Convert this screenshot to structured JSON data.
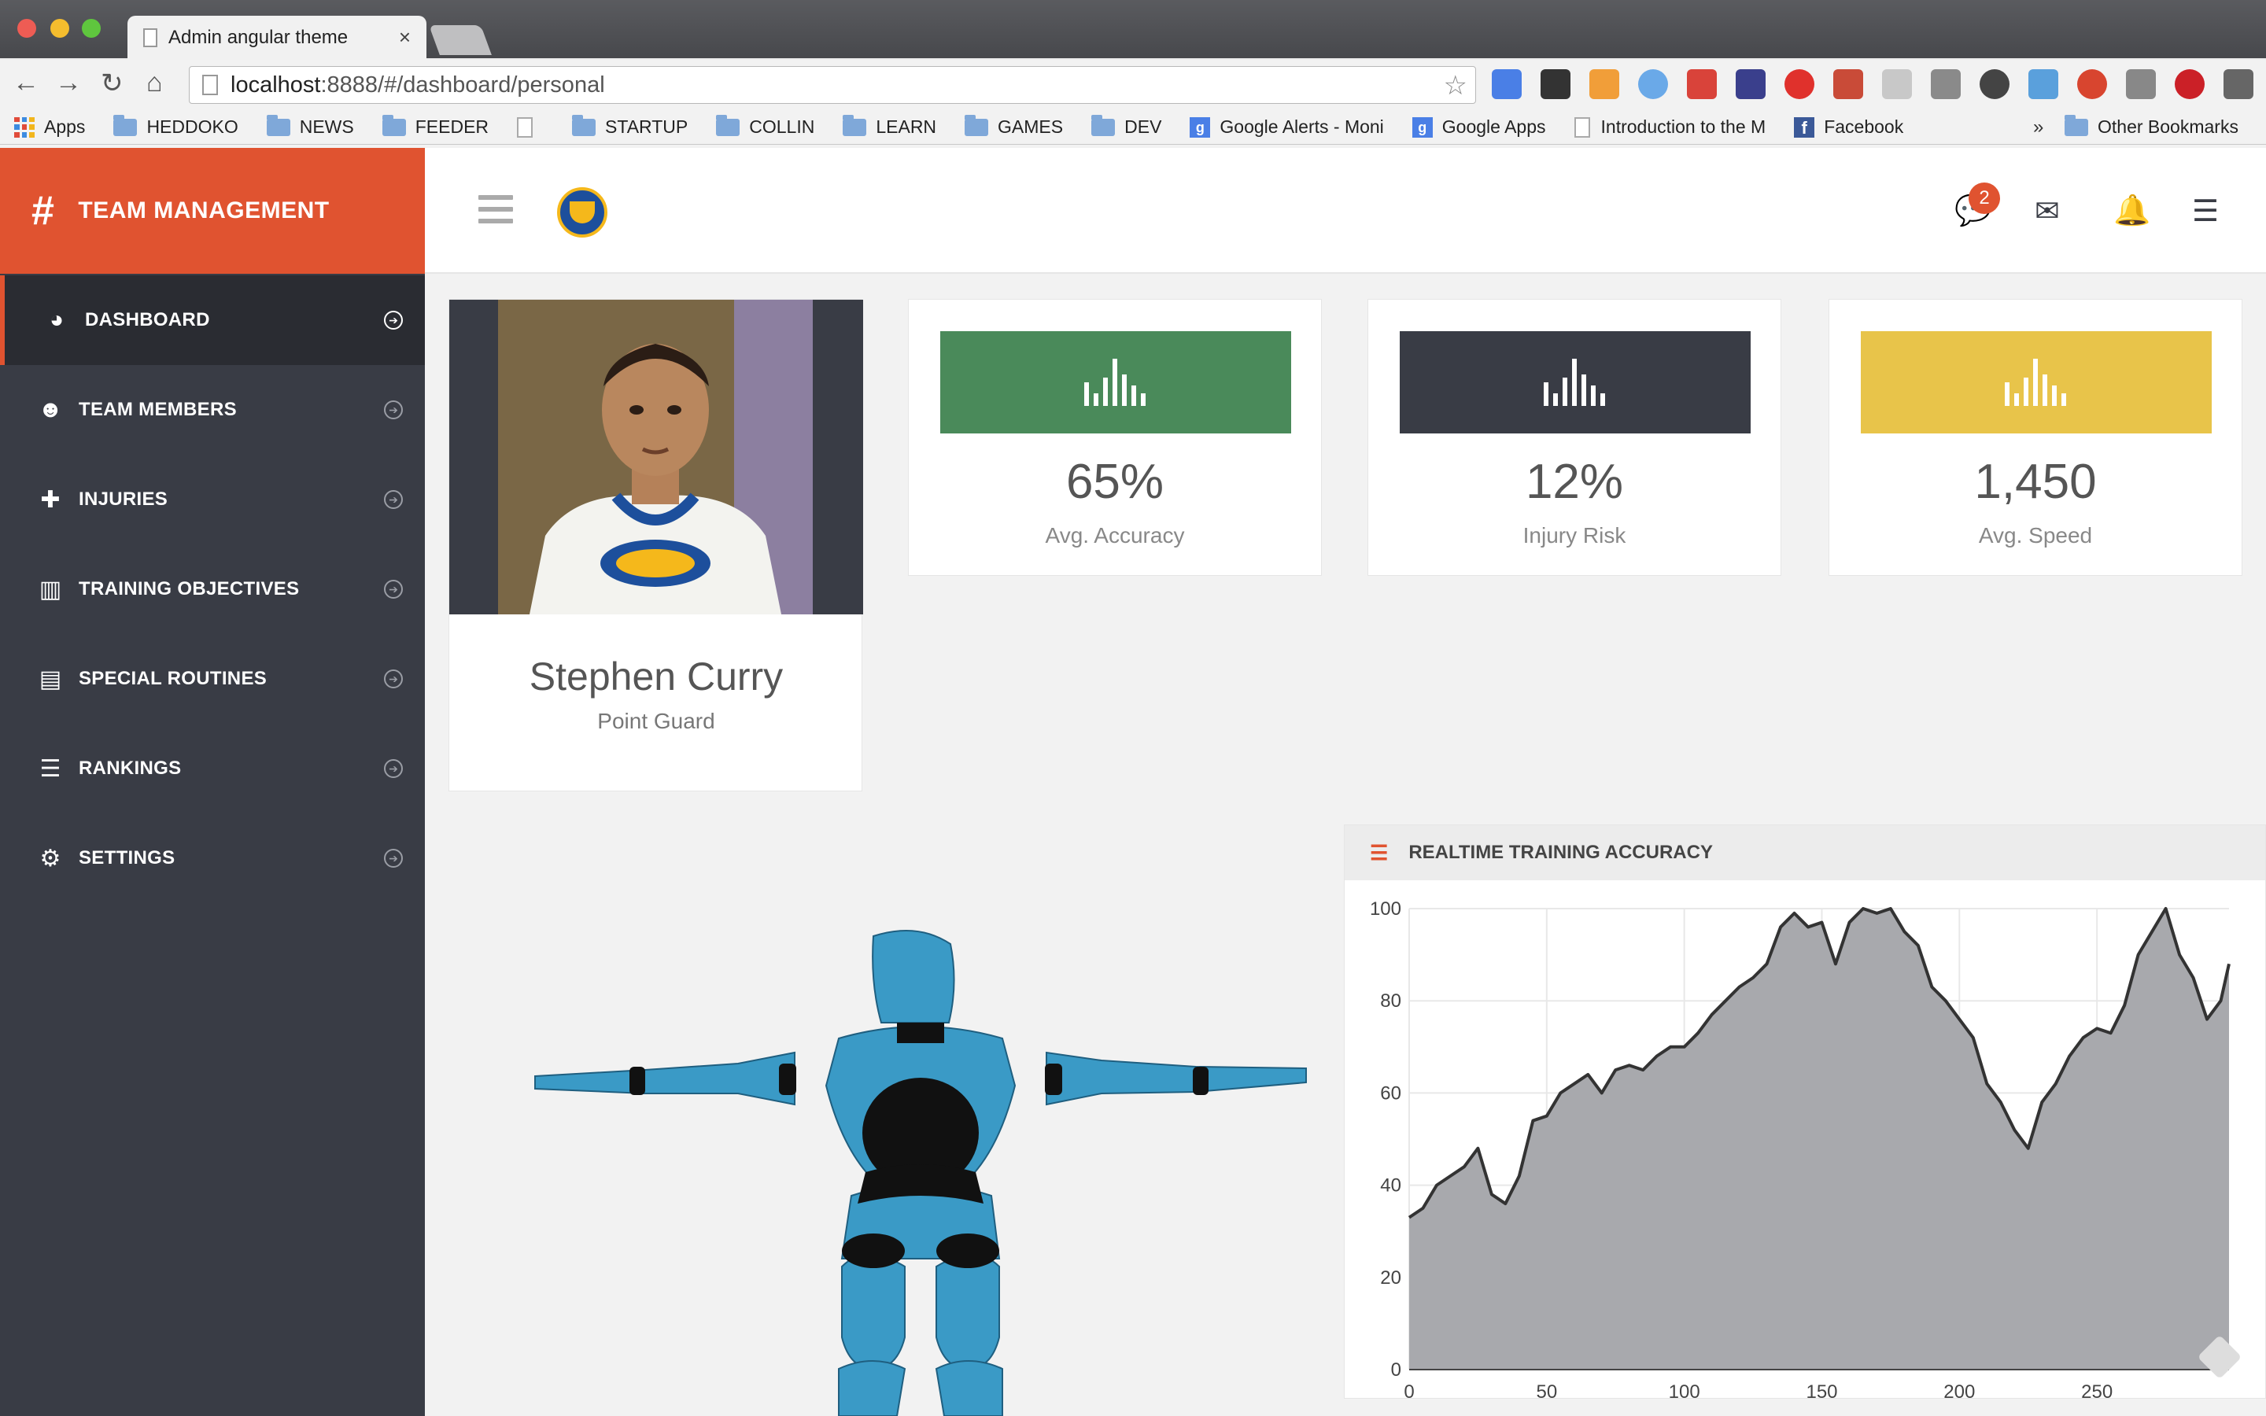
{
  "browser": {
    "tab_title": "Admin angular theme",
    "tab_close": "×",
    "url_host": "localhost",
    "url_rest": ":8888/#/dashboard/personal",
    "bookmarks": [
      {
        "label": "Apps",
        "type": "apps"
      },
      {
        "label": "HEDDOKO",
        "type": "folder"
      },
      {
        "label": "NEWS",
        "type": "folder"
      },
      {
        "label": "FEEDER",
        "type": "folder"
      },
      {
        "label": "",
        "type": "page"
      },
      {
        "label": "STARTUP",
        "type": "folder"
      },
      {
        "label": "COLLIN",
        "type": "folder"
      },
      {
        "label": "LEARN",
        "type": "folder"
      },
      {
        "label": "GAMES",
        "type": "folder"
      },
      {
        "label": "DEV",
        "type": "folder"
      },
      {
        "label": "Google Alerts - Moni",
        "type": "google"
      },
      {
        "label": "Google Apps",
        "type": "google"
      },
      {
        "label": "Introduction to the M",
        "type": "page"
      },
      {
        "label": "Facebook",
        "type": "facebook"
      }
    ],
    "bookmarks_overflow": "»",
    "other_bookmarks": "Other Bookmarks"
  },
  "sidebar": {
    "brand": "TEAM MANAGEMENT",
    "items": [
      {
        "label": "DASHBOARD",
        "icon": "dashboard-icon",
        "glyph": "◕"
      },
      {
        "label": "TEAM MEMBERS",
        "icon": "users-icon",
        "glyph": "☻"
      },
      {
        "label": "INJURIES",
        "icon": "medkit-icon",
        "glyph": "✚"
      },
      {
        "label": "TRAINING OBJECTIVES",
        "icon": "bar-chart-icon",
        "glyph": "▥"
      },
      {
        "label": "SPECIAL ROUTINES",
        "icon": "list-alt-icon",
        "glyph": "▤"
      },
      {
        "label": "RANKINGS",
        "icon": "list-ol-icon",
        "glyph": "☰"
      },
      {
        "label": "SETTINGS",
        "icon": "gear-icon",
        "glyph": "⚙"
      }
    ]
  },
  "topbar": {
    "badge_count": "2"
  },
  "profile": {
    "name": "Stephen Curry",
    "position": "Point Guard"
  },
  "stats": [
    {
      "value": "65%",
      "label": "Avg. Accuracy",
      "color": "#4a8a5a"
    },
    {
      "value": "12%",
      "label": "Injury Risk",
      "color": "#393c45"
    },
    {
      "value": "1,450",
      "label": "Avg. Speed",
      "color": "#e8c44a"
    }
  ],
  "chart_panel": {
    "title": "REALTIME TRAINING ACCURACY"
  },
  "chart_data": {
    "type": "area",
    "xlim": [
      0,
      298
    ],
    "ylim": [
      0,
      100
    ],
    "xticks": [
      0,
      50,
      100,
      150,
      200,
      250
    ],
    "yticks": [
      0,
      20,
      40,
      60,
      80,
      100
    ],
    "grid": true,
    "fill_color": "#a8a9ad",
    "line_color": "#333333",
    "x": [
      0,
      5,
      10,
      15,
      20,
      25,
      30,
      35,
      40,
      45,
      50,
      55,
      60,
      65,
      70,
      75,
      80,
      85,
      90,
      95,
      100,
      105,
      110,
      115,
      120,
      125,
      130,
      135,
      140,
      145,
      150,
      155,
      160,
      165,
      170,
      175,
      180,
      185,
      190,
      195,
      200,
      205,
      210,
      215,
      220,
      225,
      230,
      235,
      240,
      245,
      250,
      255,
      260,
      265,
      270,
      275,
      280,
      285,
      290,
      295,
      298
    ],
    "y": [
      33,
      35,
      40,
      42,
      44,
      48,
      38,
      36,
      42,
      54,
      55,
      60,
      62,
      64,
      60,
      65,
      66,
      65,
      68,
      70,
      70,
      73,
      77,
      80,
      83,
      85,
      88,
      96,
      99,
      96,
      97,
      88,
      97,
      100,
      99,
      100,
      95,
      92,
      83,
      80,
      76,
      72,
      62,
      58,
      52,
      48,
      58,
      62,
      68,
      72,
      74,
      73,
      79,
      90,
      95,
      100,
      90,
      85,
      76,
      80,
      88
    ]
  }
}
